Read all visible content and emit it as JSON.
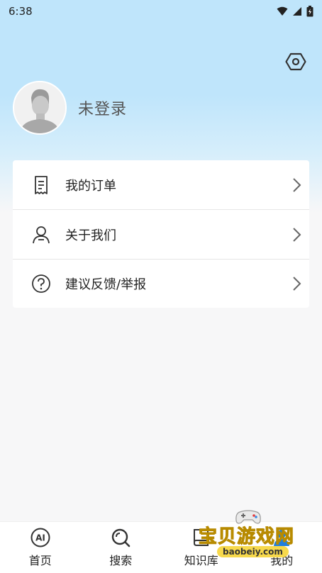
{
  "status_bar": {
    "time": "6:38"
  },
  "profile": {
    "name": "未登录"
  },
  "menu": [
    {
      "label": "我的订单",
      "icon": "receipt-icon"
    },
    {
      "label": "关于我们",
      "icon": "person-icon"
    },
    {
      "label": "建议反馈/举报",
      "icon": "question-icon"
    }
  ],
  "tabs": [
    {
      "label": "首页",
      "icon": "ai-icon"
    },
    {
      "label": "搜索",
      "icon": "search-icon"
    },
    {
      "label": "知识库",
      "icon": "book-icon"
    },
    {
      "label": "我的",
      "icon": "user-icon"
    }
  ],
  "watermark": {
    "text": "宝贝游戏网",
    "url": "baobeiy.com"
  },
  "colors": {
    "accent": "#1f7fe0",
    "header_bg": "#bfe5fb",
    "text_gray": "#555555"
  }
}
